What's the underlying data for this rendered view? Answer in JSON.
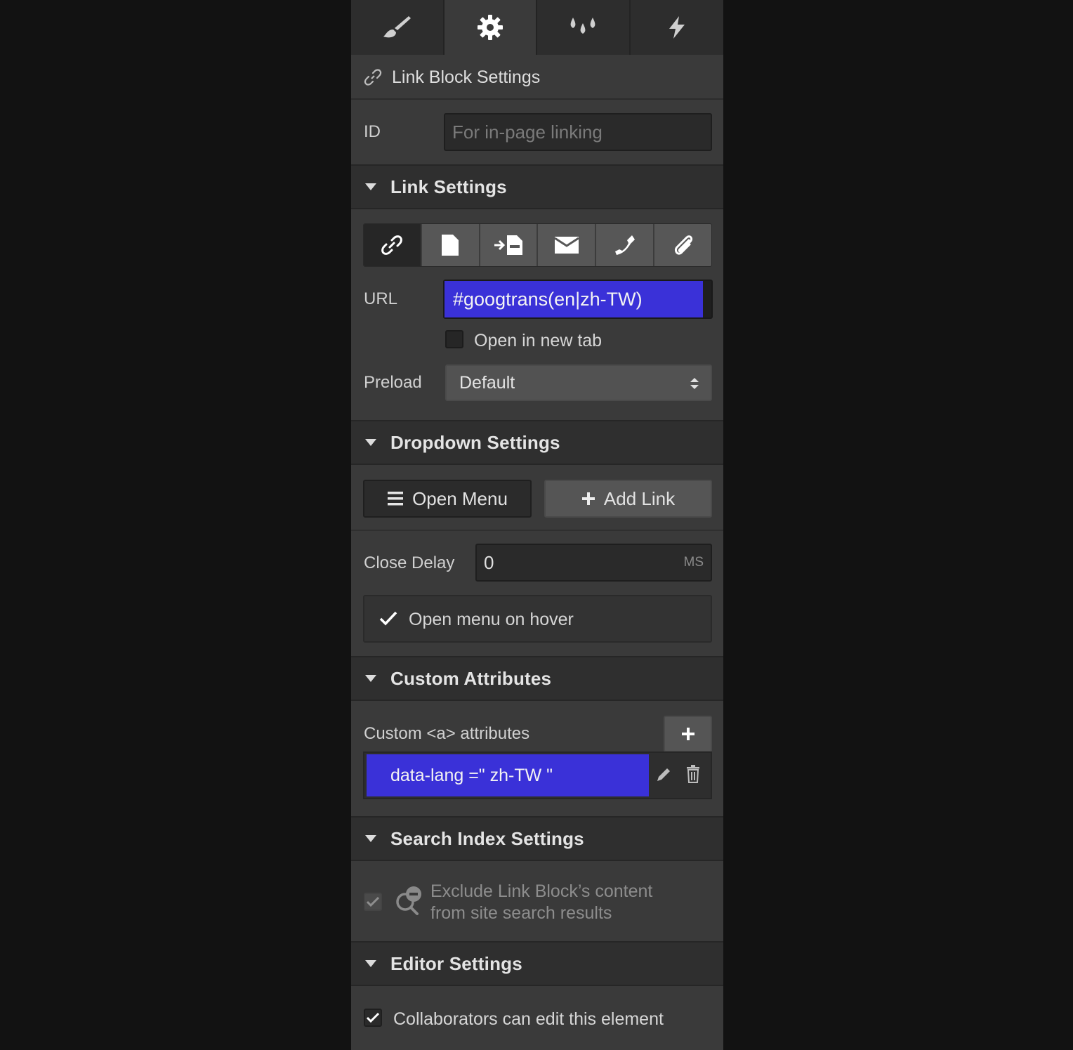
{
  "tabs": [
    {
      "icon": "brush-icon",
      "active": false
    },
    {
      "icon": "gear-icon",
      "active": true
    },
    {
      "icon": "drops-icon",
      "active": false
    },
    {
      "icon": "lightning-icon",
      "active": false
    }
  ],
  "link_block": {
    "title": "Link Block Settings",
    "id_label": "ID",
    "id_placeholder": "For in-page linking"
  },
  "link_settings": {
    "title": "Link Settings",
    "link_types": [
      "url-link-icon",
      "page-icon",
      "section-anchor-icon",
      "email-icon",
      "phone-icon",
      "attachment-icon"
    ],
    "url_label": "URL",
    "url_value": "#googtrans(en|zh-TW)",
    "open_new_tab_label": "Open in new tab",
    "open_new_tab_checked": false,
    "preload_label": "Preload",
    "preload_value": "Default"
  },
  "dropdown_settings": {
    "title": "Dropdown Settings",
    "open_menu_label": "Open Menu",
    "add_link_label": "Add Link",
    "close_delay_label": "Close Delay",
    "close_delay_value": "0",
    "close_delay_unit": "MS",
    "hover_label": "Open menu on hover",
    "hover_checked": true
  },
  "custom_attributes": {
    "title": "Custom Attributes",
    "list_label": "Custom <a> attributes",
    "items": [
      {
        "text": "data-lang =\" zh-TW \""
      }
    ]
  },
  "search_index": {
    "title": "Search Index Settings",
    "exclude_line1": "Exclude Link Block’s content",
    "exclude_line2": "from site search results",
    "exclude_checked": true
  },
  "editor_settings": {
    "title": "Editor Settings",
    "collab_label": "Collaborators can edit this element",
    "collab_checked": true
  },
  "colors": {
    "accent_selection": "#3a31d8",
    "panel_bg": "#3a3a3a",
    "page_bg": "#121212"
  }
}
